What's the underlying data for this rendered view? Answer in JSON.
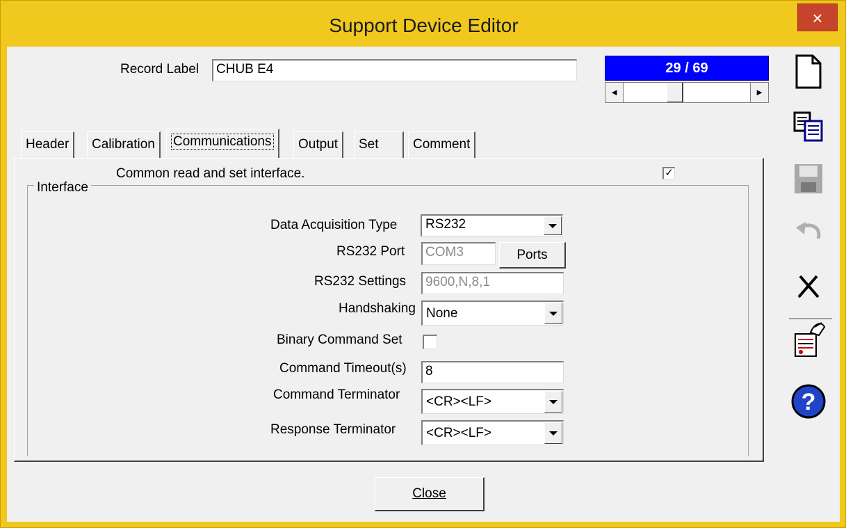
{
  "window": {
    "title": "Support Device Editor",
    "close_glyph": "×"
  },
  "record": {
    "label": "Record Label",
    "value": "CHUB E4"
  },
  "navigator": {
    "position": "29 / 69",
    "left_arrow": "◄",
    "right_arrow": "►"
  },
  "tabs": [
    {
      "label": "Header"
    },
    {
      "label": "Calibration"
    },
    {
      "label": "Communications"
    },
    {
      "label": "Output"
    },
    {
      "label": "Set"
    },
    {
      "label": "Comment"
    }
  ],
  "active_tab": "Communications",
  "common_interface": {
    "label": "Common read and set interface.",
    "checked": true,
    "check_glyph": "✓"
  },
  "group": {
    "title": "Interface"
  },
  "fields": {
    "acq_type": {
      "label": "Data Acquisition Type",
      "value": "RS232"
    },
    "port": {
      "label": "RS232 Port",
      "value": "COM3",
      "button": "Ports"
    },
    "settings": {
      "label": "RS232 Settings",
      "value": "9600,N,8,1"
    },
    "handshaking": {
      "label": "Handshaking",
      "value": "None"
    },
    "binary": {
      "label": "Binary Command Set",
      "checked": false
    },
    "timeout": {
      "label": "Command Timeout(s)",
      "value": "8"
    },
    "cmd_term": {
      "label": "Command Terminator",
      "value": "<CR><LF>"
    },
    "resp_term": {
      "label": "Response Terminator",
      "value": "<CR><LF>"
    }
  },
  "close_button": {
    "label": "Close"
  },
  "toolbar_icons": [
    "new-document-icon",
    "copy-icon",
    "save-icon",
    "undo-icon",
    "delete-icon",
    "wizard-icon",
    "help-icon"
  ],
  "colors": {
    "title_bar": "#f0c81e",
    "close_button": "#c7442c",
    "navigator_bg": "#0000ff",
    "help_blue": "#1f44c8"
  }
}
